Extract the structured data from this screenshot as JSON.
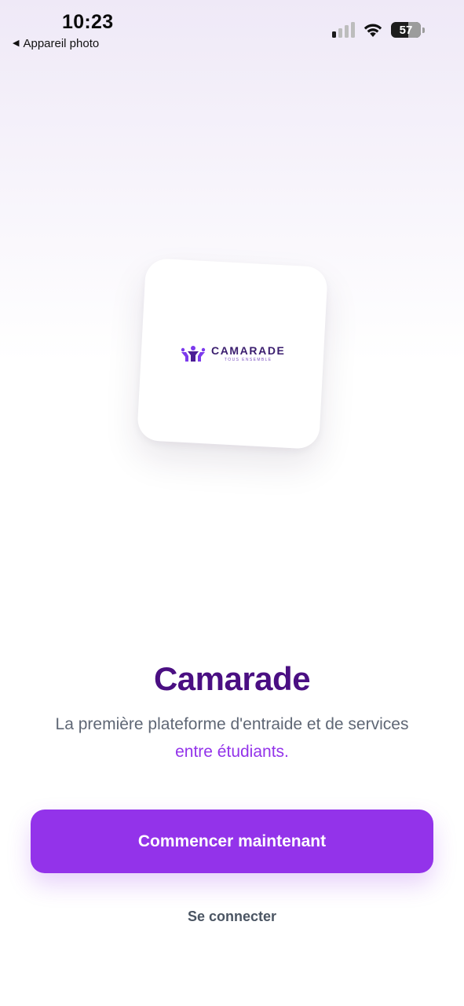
{
  "status_bar": {
    "time": "10:23",
    "back_app_label": "Appareil photo",
    "battery_level": "57",
    "battery_fraction": 0.57,
    "signal_bars_active": 1,
    "signal_bars_total": 4
  },
  "logo": {
    "brand_name": "CAMARADE",
    "brand_tagline": "TOUS ENSEMBLE"
  },
  "hero": {
    "title": "Camarade",
    "tagline_main": "La première plateforme d'entraide et de services",
    "tagline_accent": "entre étudiants."
  },
  "actions": {
    "primary_label": "Commencer maintenant",
    "secondary_label": "Se connecter"
  },
  "colors": {
    "primary": "#9333ea",
    "title": "#4a0f82",
    "muted_text": "#5f6775",
    "link_text": "#4b5563"
  },
  "icons": [
    "back-arrow-icon",
    "cellular-signal-icon",
    "wifi-icon",
    "battery-icon",
    "camarade-logo-icon"
  ]
}
